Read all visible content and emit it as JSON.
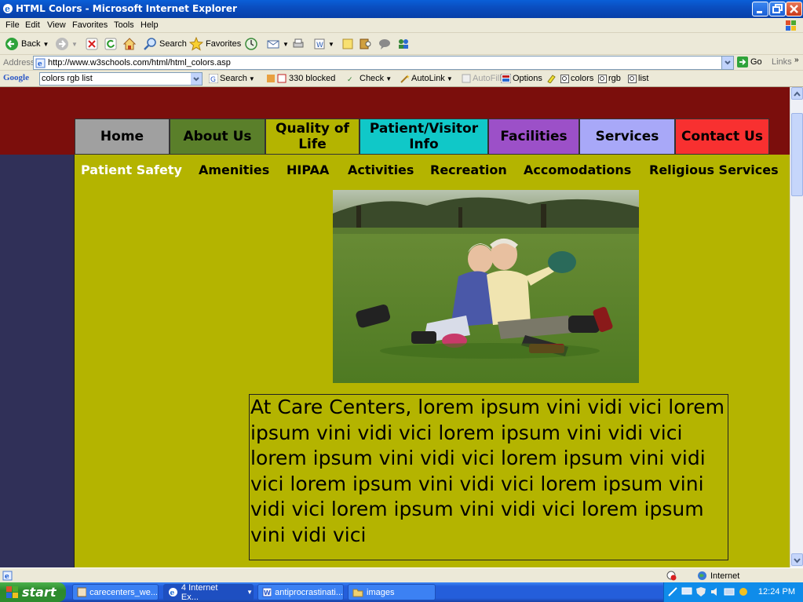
{
  "window": {
    "title": "HTML Colors - Microsoft Internet Explorer"
  },
  "menu": [
    "File",
    "Edit",
    "View",
    "Favorites",
    "Tools",
    "Help"
  ],
  "toolbar": {
    "back": "Back",
    "search": "Search",
    "favorites": "Favorites"
  },
  "address": {
    "label": "Address",
    "url": "http://www.w3schools.com/html/html_colors.asp",
    "go": "Go",
    "links": "Links"
  },
  "google": {
    "logo": "Google",
    "query": "colors rgb list",
    "search": "Search",
    "blocked": "330 blocked",
    "check": "Check",
    "autolink": "AutoLink",
    "autofill": "AutoFill",
    "options": "Options",
    "highlights": [
      "colors",
      "rgb",
      "list"
    ]
  },
  "page": {
    "colors": {
      "top_band": "#7b0e0c",
      "left_column": "#303058",
      "content": "#b4b400"
    },
    "nav": [
      {
        "label": "Home",
        "bg": "#a0a0a0"
      },
      {
        "label": "About Us",
        "bg": "#5a7f2a"
      },
      {
        "label": "Quality of Life",
        "bg": "#b4b400"
      },
      {
        "label": "Patient/Visitor Info",
        "bg": "#10c8c8"
      },
      {
        "label": "Facilities",
        "bg": "#9c50c8"
      },
      {
        "label": "Services",
        "bg": "#a8a8f8"
      },
      {
        "label": "Contact Us",
        "bg": "#f83030"
      }
    ],
    "subnav": [
      "Patient Safety",
      "Amenities",
      "HIPAA",
      "Activities",
      "Recreation",
      "Accomodations",
      "Religious Services"
    ],
    "body_text": "At Care Centers, lorem ipsum vini vidi vici lorem ipsum vini vidi vici lorem ipsum vini vidi vici lorem ipsum vini vidi vici lorem ipsum vini vidi vici lorem ipsum vini vidi vici lorem ipsum vini vidi vici lorem ipsum vini vidi vici lorem ipsum vini vidi vici"
  },
  "status": {
    "zone": "Internet"
  },
  "taskbar": {
    "start": "start",
    "tasks": [
      "carecenters_we...",
      "4 Internet Ex...",
      "antiprocrastinati...",
      "images"
    ],
    "clock": "12:24 PM"
  }
}
